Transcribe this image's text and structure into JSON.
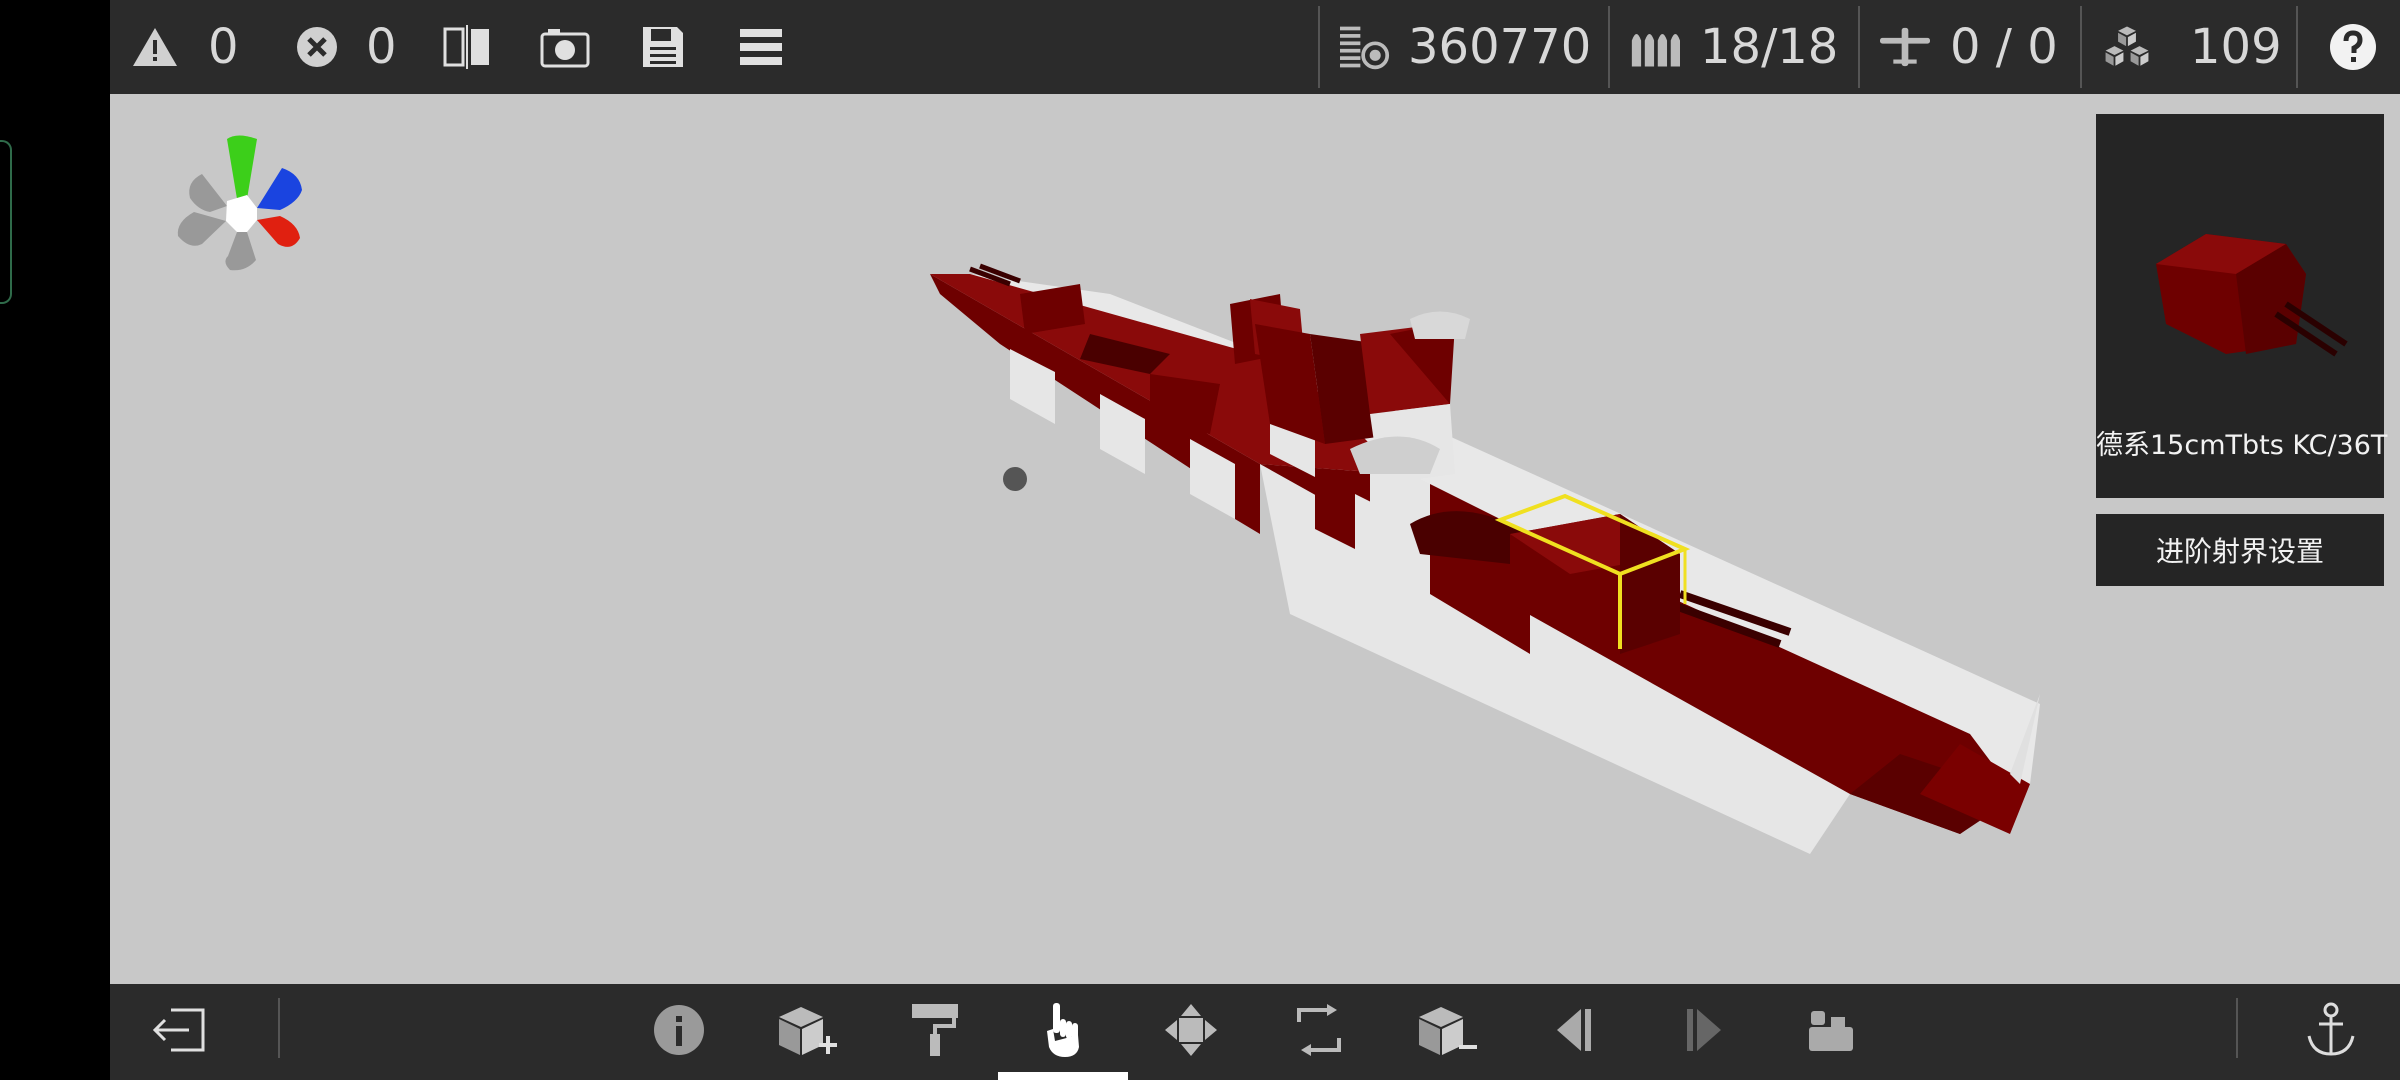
{
  "topbar": {
    "warnings_count": "0",
    "errors_count": "0",
    "cost_value": "360770",
    "ammo_value": "18/18",
    "aircraft_value": "0 / 0",
    "parts_value": "109",
    "icons": [
      "warning-icon",
      "error-icon",
      "mirror-icon",
      "camera-icon",
      "save-icon",
      "menu-icon",
      "cost-icon",
      "ammo-icon",
      "aircraft-icon",
      "parts-icon",
      "help-icon"
    ]
  },
  "preview": {
    "part_name": "德系15cmTbts KC/36T"
  },
  "advanced_button_label": "进阶射界设置",
  "bottombar": {
    "tools": [
      "exit-icon",
      "info-icon",
      "add-part-icon",
      "paint-roller-icon",
      "hand-select-icon",
      "move-icon",
      "rotate-icon",
      "remove-part-icon",
      "undo-icon",
      "redo-icon",
      "crew-icon",
      "anchor-icon"
    ],
    "active_tool": "hand-select-icon"
  },
  "colors": {
    "bar_bg": "#2b2b2b",
    "viewport_bg": "#c8c8c8",
    "hull_red": "#6e0000",
    "hull_white": "#e6e6e6",
    "selection_yellow": "#f0e020",
    "gizmo_green": "#3ccf1a",
    "gizmo_blue": "#1a44e0",
    "gizmo_red": "#e02010"
  }
}
